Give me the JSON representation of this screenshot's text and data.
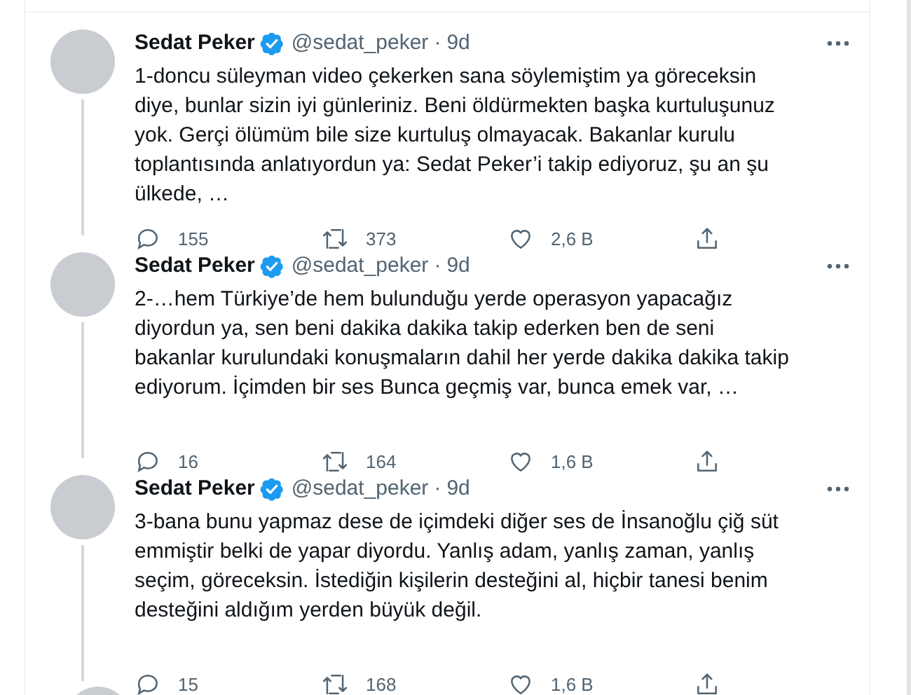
{
  "tweets": [
    {
      "name": "Sedat Peker",
      "handle": "@sedat_peker",
      "separator": "·",
      "time": "9d",
      "verified": true,
      "thread": true,
      "text": "1-doncu süleyman video çekerken sana söylemiştim ya göreceksin diye, bunlar sizin iyi günleriniz. Beni öldürmekten başka kurtuluşunuz yok. Gerçi ölümüm bile size kurtuluş olmayacak. Bakanlar kurulu toplantısında anlatıyordun ya: Sedat Peker’i takip ediyoruz, şu an şu ülkede, …",
      "replies": "155",
      "retweets": "373",
      "likes": "2,6 B"
    },
    {
      "name": "Sedat Peker",
      "handle": "@sedat_peker",
      "separator": "·",
      "time": "9d",
      "verified": true,
      "thread": true,
      "text": "2-…hem Türkiye’de hem bulunduğu yerde operasyon yapacağız diyordun ya, sen beni dakika dakika takip ederken ben de seni bakanlar kurulundaki konuşmaların dahil her yerde dakika dakika takip ediyorum. İçimden bir ses Bunca geçmiş var, bunca emek var, …",
      "replies": "16",
      "retweets": "164",
      "likes": "1,6 B"
    },
    {
      "name": "Sedat Peker",
      "handle": "@sedat_peker",
      "separator": "·",
      "time": "9d",
      "verified": true,
      "thread": true,
      "text": "3-bana bunu yapmaz dese de içimdeki diğer ses de İnsanoğlu çiğ süt emmiştir belki de yapar diyordu. Yanlış adam, yanlış zaman, yanlış seçim, göreceksin. İstediğin kişilerin desteğini al, hiçbir tanesi benim desteğini aldığım yerden büyük değil.",
      "replies": "15",
      "retweets": "168",
      "likes": "1,6 B"
    }
  ]
}
